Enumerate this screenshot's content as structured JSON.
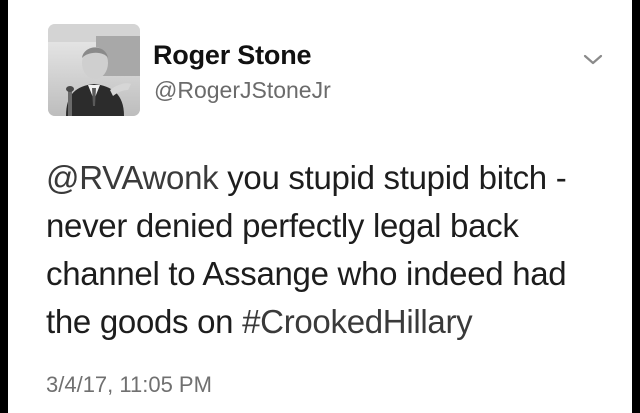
{
  "tweet": {
    "author": {
      "name": "Roger Stone",
      "handle": "@RogerJStoneJr"
    },
    "body": {
      "mention": "@RVAwonk",
      "text_1": " you stupid stupid bitch - never denied perfectly legal back channel to Assange who indeed had the goods on ",
      "hashtag": "#CrookedHillary"
    },
    "timestamp": "3/4/17, 11:05 PM",
    "caret_icon": "chevron-down-icon"
  },
  "colors": {
    "frame_border": "#000000",
    "background": "#ffffff",
    "text": "#1d1d1d",
    "secondary_text": "#6b6b6b",
    "link_text": "#3a3a3a"
  }
}
